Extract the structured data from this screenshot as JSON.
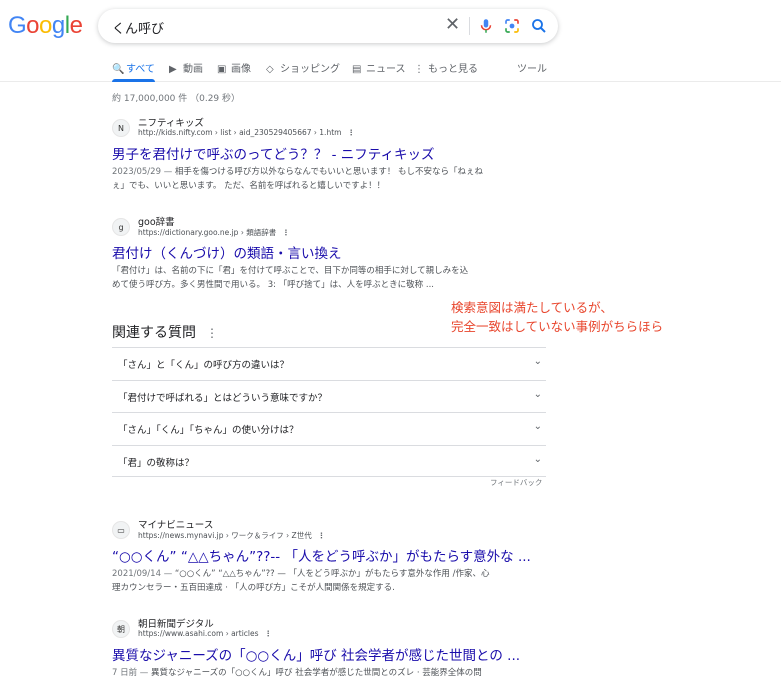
{
  "logo": {
    "l1": "G",
    "l2": "o",
    "l3": "o",
    "l4": "g",
    "l5": "l",
    "l6": "e"
  },
  "search": {
    "query": "くん呼び"
  },
  "tabs": [
    {
      "icon": "🔍",
      "label": "すべて"
    },
    {
      "icon": "▶",
      "label": "動画"
    },
    {
      "icon": "▣",
      "label": "画像"
    },
    {
      "icon": "◇",
      "label": "ショッピング"
    },
    {
      "icon": "▤",
      "label": "ニュース"
    },
    {
      "icon": "⋮",
      "label": "もっと見る"
    }
  ],
  "tools_label": "ツール",
  "stats": "約 17,000,000 件 （0.29 秒）",
  "results": [
    {
      "favicon": "N",
      "site": "ニフティキッズ",
      "url": "http://kids.nifty.com › list › aid_230529405667 › 1.htm",
      "title": "男子を君付けで呼ぶのってどう？？ - ニフティキッズ",
      "date": "2023/05/29 — ",
      "snippet_line1": "相手を傷つける呼び方以外ならなんでもいいと思います！ もし不安なら「ねぇね",
      "snippet_line2": "ぇ」でも、いいと思います。 ただ、名前を呼ばれると嬉しいですよ！！"
    },
    {
      "favicon": "g",
      "site": "goo辞書",
      "url": "https://dictionary.goo.ne.jp › 類語辞書",
      "title": "君付け（くんづけ）の類語・言い換え",
      "date": "",
      "snippet_line1": "「君付け」は、名前の下に「君」を付けて呼ぶことで、目下か同等の相手に対して親しみを込",
      "snippet_line2": "めて使う呼び方。多く男性間で用いる。 3: 「呼び捨て」は、人を呼ぶときに敬称 ..."
    },
    {
      "favicon": "▭",
      "site": "マイナビニュース",
      "url": "https://news.mynavi.jp › ワーク＆ライフ › Z世代",
      "title": "“○○くん” “△△ちゃん”??-- 「人をどう呼ぶか」がもたらす意外な ...",
      "date": "2021/09/14 — ",
      "snippet_line1": "“○○くん” “△△ちゃん”?? — 「人をどう呼ぶか」がもたらす意外な作用 /作家、心",
      "snippet_line2": "理カウンセラー・五百田達成 · 「人の呼び方」こそが人間関係を規定する."
    },
    {
      "favicon": "朝",
      "site": "朝日新聞デジタル",
      "url": "https://www.asahi.com › articles",
      "title": "異質なジャニーズの「○○くん」呼び 社会学者が感じた世間との ...",
      "date": "7 日前 — ",
      "snippet_line1": "異質なジャニーズの「○○くん」呼び 社会学者が感じた世間とのズレ · 芸能界全体の問",
      "snippet_line2": ""
    }
  ],
  "paa": {
    "heading": "関連する質問",
    "questions": [
      "「さん」と「くん」の呼び方の違いは？",
      "「君付けで呼ばれる」とはどういう意味ですか？",
      "「さん」「くん」「ちゃん」の使い分けは？",
      "「君」の敬称は？"
    ],
    "feedback": "フィードバック"
  },
  "annotation": {
    "line1": "検索意図は満たしているが、",
    "line2": "完全一致はしていない事例がちらほら"
  },
  "colors": {
    "link": "#1a0dab",
    "accent": "#1a73e8",
    "annotation": "#e8452c"
  }
}
